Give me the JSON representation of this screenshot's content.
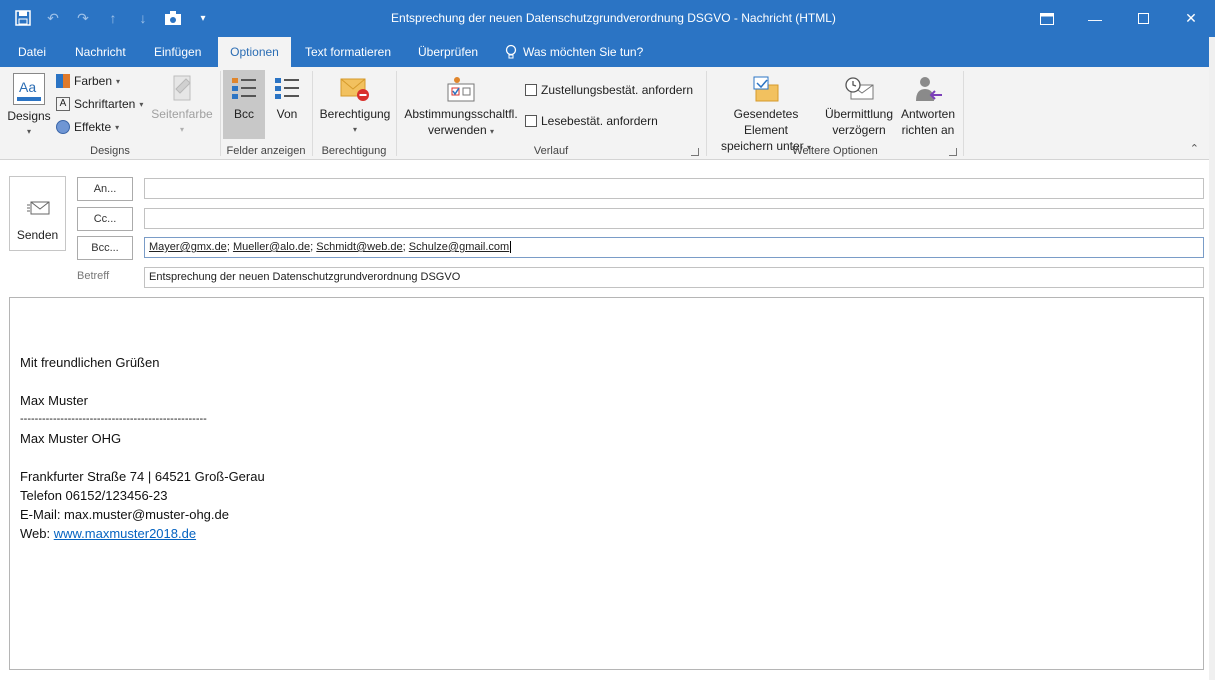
{
  "window": {
    "title": "Entsprechung der neuen Datenschutzgrundverordnung DSGVO  -  Nachricht (HTML)",
    "accent": "#2b74c4"
  },
  "quick_access": {
    "icons": [
      "save-icon",
      "undo-icon",
      "redo-icon",
      "up-icon",
      "down-icon",
      "camera-icon",
      "customize-icon"
    ]
  },
  "tabs": [
    "Datei",
    "Nachricht",
    "Einfügen",
    "Optionen",
    "Text formatieren",
    "Überprüfen"
  ],
  "active_tab": "Optionen",
  "tell_me": "Was möchten Sie tun?",
  "ribbon": {
    "designs_group": {
      "label": "Designs",
      "designs_btn": "Designs",
      "farben": "Farben",
      "schriftarten": "Schriftarten",
      "effekte": "Effekte",
      "seitenfarbe": "Seitenfarbe"
    },
    "felder_group": {
      "label": "Felder anzeigen",
      "bcc": "Bcc",
      "von": "Von"
    },
    "berechtigung_group": {
      "label": "Berechtigung",
      "berechtigung": "Berechtigung"
    },
    "verlauf_group": {
      "label": "Verlauf",
      "abstimmung_line1": "Abstimmungsschaltfl.",
      "abstimmung_line2": "verwenden",
      "zustellung": "Zustellungsbestät. anfordern",
      "lese": "Lesebestät. anfordern"
    },
    "weitere_group": {
      "label": "Weitere Optionen",
      "gesendet_line1": "Gesendetes Element",
      "gesendet_line2": "speichern unter",
      "uebermittlung_line1": "Übermittlung",
      "uebermittlung_line2": "verzögern",
      "antworten_line1": "Antworten",
      "antworten_line2": "richten an"
    }
  },
  "compose": {
    "send_label": "Senden",
    "an_label": "An...",
    "cc_label": "Cc...",
    "bcc_label": "Bcc...",
    "an_value": "",
    "cc_value": "",
    "bcc_recipients": [
      "Mayer@gmx.de",
      "Mueller@alo.de",
      "Schmidt@web.de",
      "Schulze@gmail.com"
    ],
    "betreff_label": "Betreff",
    "betreff_value": "Entsprechung der neuen Datenschutzgrundverordnung DSGVO"
  },
  "body": {
    "greeting": "Mit freundlichen Grüßen",
    "name": "Max Muster",
    "divider": "---------------------------------------------------",
    "company": "Max Muster OHG",
    "address": "Frankfurter Straße 74 | 64521 Groß-Gerau",
    "phone": "Telefon 06152/123456-23",
    "email": "E-Mail: max.muster@muster-ohg.de",
    "web_prefix": "Web: ",
    "web_link": "www.maxmuster2018.de"
  }
}
